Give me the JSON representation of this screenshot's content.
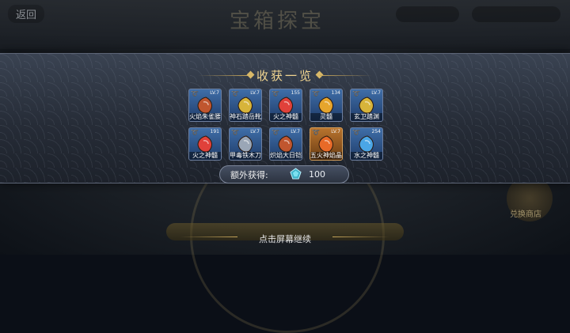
{
  "background": {
    "back_label": "返回",
    "title": "宝箱探宝",
    "shop_label": "兑换商店"
  },
  "panel": {
    "title": "收获一览",
    "items": [
      {
        "name": "火焰朱雀腰",
        "level": "LV.7",
        "color": "blue",
        "icon": "armor-icon"
      },
      {
        "name": "神石踏岳靴",
        "level": "LV.7",
        "color": "blue",
        "icon": "boots-icon"
      },
      {
        "name": "火之神髓",
        "level": "155",
        "color": "blue",
        "icon": "fire-essence-icon"
      },
      {
        "name": "灵髓",
        "level": "134",
        "color": "blue",
        "icon": "spirit-essence-icon"
      },
      {
        "name": "玄卫踏渊",
        "level": "LV.7",
        "color": "blue",
        "icon": "boots-icon"
      },
      {
        "name": "火之神髓",
        "level": "191",
        "color": "blue",
        "icon": "fire-essence-icon"
      },
      {
        "name": "甲毒铁木刀",
        "level": "LV.7",
        "color": "blue",
        "icon": "blade-icon"
      },
      {
        "name": "炽焰大日铠",
        "level": "LV.7",
        "color": "blue",
        "icon": "armor-icon"
      },
      {
        "name": "五火神焰晶",
        "level": "LV.7",
        "color": "orange",
        "icon": "flame-crystal-icon"
      },
      {
        "name": "水之神髓",
        "level": "254",
        "color": "blue",
        "icon": "water-essence-icon"
      }
    ],
    "extra_label": "额外获得:",
    "extra_icon": "gem-icon",
    "extra_value": "100"
  },
  "footer": {
    "continue_label": "点击屏幕继续"
  }
}
